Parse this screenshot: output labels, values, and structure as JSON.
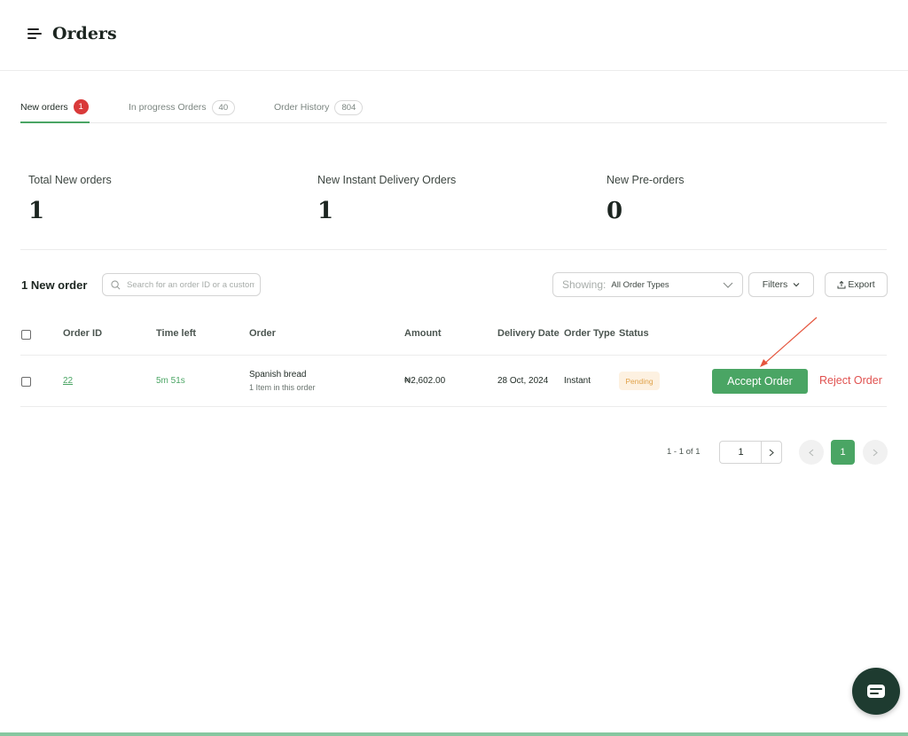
{
  "header": {
    "title": "Orders"
  },
  "tabs": [
    {
      "label": "New orders",
      "count": "1"
    },
    {
      "label": "In progress Orders",
      "count": "40"
    },
    {
      "label": "Order History",
      "count": "804"
    }
  ],
  "stats": [
    {
      "label": "Total New orders",
      "value": "1"
    },
    {
      "label": "New Instant Delivery Orders",
      "value": "1"
    },
    {
      "label": "New Pre-orders",
      "value": "0"
    }
  ],
  "toolbar": {
    "count_title": "1 New order",
    "search_placeholder": "Search for an order ID or a customer",
    "showing_label": "Showing:",
    "showing_value": "All Order Types",
    "filters_label": "Filters",
    "export_label": "Export"
  },
  "table": {
    "columns": [
      "Order ID",
      "Time left",
      "Order",
      "Amount",
      "Delivery Date",
      "Order Type",
      "Status"
    ],
    "rows": [
      {
        "order_id": "22",
        "time_left": "5m 51s",
        "order_name": "Spanish bread",
        "order_items": "1 Item in this order",
        "amount": "₦2,602.00",
        "delivery_date": "28 Oct, 2024",
        "order_type": "Instant",
        "status": "Pending",
        "accept_label": "Accept Order",
        "reject_label": "Reject Order"
      }
    ]
  },
  "pagination": {
    "range": "1 - 1 of 1",
    "page_input": "1",
    "current_page": "1"
  },
  "colors": {
    "accent": "#4aa564",
    "danger": "#e0514f",
    "badge_red": "#d93a3a",
    "pending_bg": "#fdf1e1",
    "pending_text": "#e0a24a",
    "chat_bg": "#1e3b30"
  },
  "icons": [
    "menu-icon",
    "search-icon",
    "chevron-down-icon",
    "export-icon",
    "chevron-right-icon",
    "chevron-left-icon",
    "chat-icon"
  ]
}
